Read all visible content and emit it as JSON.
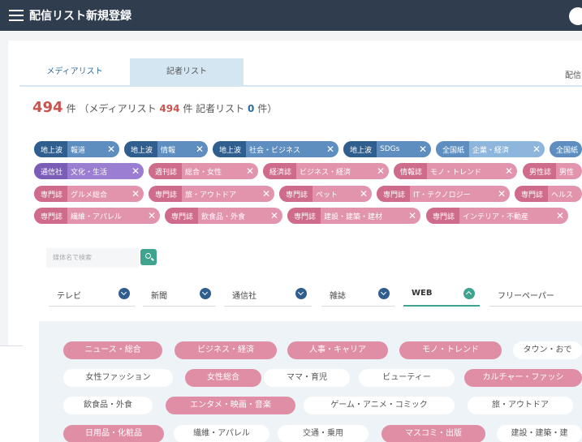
{
  "header": {
    "title": "配信リスト新規登録",
    "menu_icon": "hamburger-menu-icon"
  },
  "tabs": [
    {
      "label": "メディアリスト",
      "active": true
    },
    {
      "label": "記者リスト",
      "active": false
    }
  ],
  "tab_right_label": "配信",
  "summary": {
    "total": "494",
    "unit": "件",
    "media_prefix": "（メディアリスト",
    "media_count": "494",
    "media_unit": "件",
    "reporter_prefix": "記者リスト",
    "reporter_count": "0",
    "reporter_suffix": "件）"
  },
  "chips": [
    {
      "cat": "地上波",
      "label": "報道"
    },
    {
      "cat": "地上波",
      "label": "情報"
    },
    {
      "cat": "地上波",
      "label": "社会・ビジネス"
    },
    {
      "cat": "地上波",
      "label": "SDGs"
    },
    {
      "cat": "全国紙",
      "label": "企業・経済"
    },
    {
      "cat": "全国紙",
      "label": ""
    },
    {
      "cat": "通信社",
      "label": "文化・生活"
    },
    {
      "cat": "週刊誌",
      "label": "総合・女性"
    },
    {
      "cat": "経済誌",
      "label": "ビジネス・経済"
    },
    {
      "cat": "情報誌",
      "label": "モノ・トレンド"
    },
    {
      "cat": "男性誌",
      "label": "男性"
    },
    {
      "cat": "専門誌",
      "label": "グルメ総合"
    },
    {
      "cat": "専門誌",
      "label": "旅・アウトドア"
    },
    {
      "cat": "専門誌",
      "label": "ペット"
    },
    {
      "cat": "専門誌",
      "label": "IT・テクノロジー"
    },
    {
      "cat": "専門誌",
      "label": "ヘルス"
    },
    {
      "cat": "専門誌",
      "label": "繊維・アパレル"
    },
    {
      "cat": "専門誌",
      "label": "飲食品・外食"
    },
    {
      "cat": "専門誌",
      "label": "建設・建築・建材"
    },
    {
      "cat": "専門誌",
      "label": "インテリア・不動産"
    }
  ],
  "search": {
    "placeholder": "媒体名で検索"
  },
  "media_tabs": [
    {
      "label": "テレビ"
    },
    {
      "label": "新聞"
    },
    {
      "label": "通信社"
    },
    {
      "label": "雑誌"
    },
    {
      "label": "WEB",
      "active": true
    },
    {
      "label": "フリーペーパー"
    }
  ],
  "genres": [
    {
      "label": "ニュース・総合",
      "selected": true
    },
    {
      "label": "ビジネス・経済",
      "selected": true
    },
    {
      "label": "人事・キャリア",
      "selected": true
    },
    {
      "label": "モノ・トレンド",
      "selected": true
    },
    {
      "label": "タウン・おで",
      "selected": false
    },
    {
      "label": "女性ファッション",
      "selected": false
    },
    {
      "label": "女性総合",
      "selected": true
    },
    {
      "label": "ママ・育児",
      "selected": false
    },
    {
      "label": "ビューティー",
      "selected": false
    },
    {
      "label": "カルチャー・ファッシ",
      "selected": true
    },
    {
      "label": "飲食品・外食",
      "selected": false
    },
    {
      "label": "エンタメ・映画・音楽",
      "selected": true
    },
    {
      "label": "ゲーム・アニメ・コミック",
      "selected": false
    },
    {
      "label": "旅・アウトドア",
      "selected": false
    },
    {
      "label": "日用品・化粧品",
      "selected": true
    },
    {
      "label": "繊維・アパレル",
      "selected": false
    },
    {
      "label": "交通・乗用",
      "selected": false
    },
    {
      "label": "マスコミ・出版",
      "selected": true
    },
    {
      "label": "建設・建築・建",
      "selected": false
    }
  ],
  "colors": {
    "header": "#2f3d4f",
    "chip_blue": "#2f5e8f",
    "chip_pink": "#e08ea5",
    "accent_green": "#3fa38f",
    "count_red": "#c85450"
  }
}
